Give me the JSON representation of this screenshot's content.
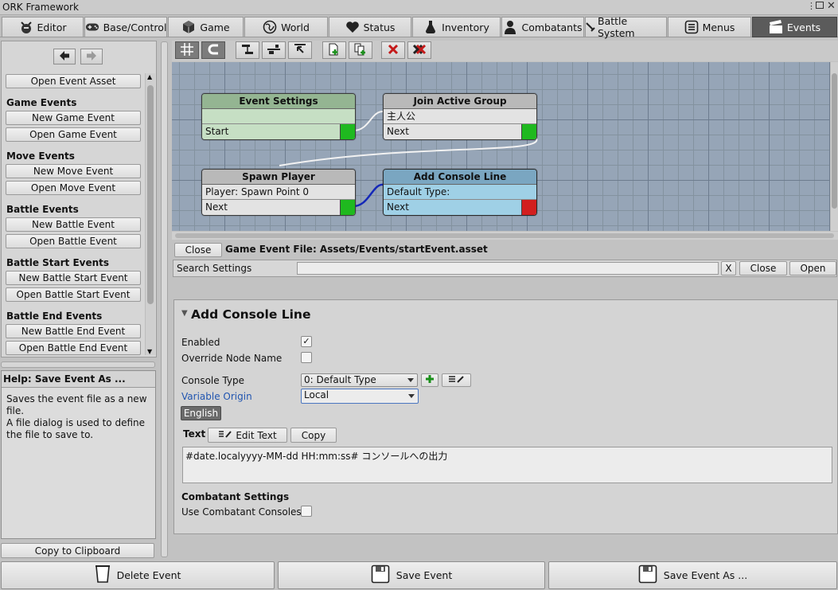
{
  "window": {
    "title": "ORK Framework"
  },
  "tabs": [
    {
      "label": "Editor",
      "icon": "ork-icon"
    },
    {
      "label": "Base/Control",
      "icon": "gamepad-icon"
    },
    {
      "label": "Game",
      "icon": "cube-icon"
    },
    {
      "label": "World",
      "icon": "globe-icon"
    },
    {
      "label": "Status",
      "icon": "heart-icon"
    },
    {
      "label": "Inventory",
      "icon": "potion-icon"
    },
    {
      "label": "Combatants",
      "icon": "person-icon"
    },
    {
      "label": "Battle System",
      "icon": "sword-icon"
    },
    {
      "label": "Menus",
      "icon": "menu-icon"
    },
    {
      "label": "Events",
      "icon": "clapperboard-icon",
      "active": true
    }
  ],
  "sidebar": {
    "open_event_asset": "Open Event Asset",
    "sections": [
      {
        "title": "Game Events",
        "new": "New Game Event",
        "open": "Open Game Event"
      },
      {
        "title": "Move Events",
        "new": "New Move Event",
        "open": "Open Move Event"
      },
      {
        "title": "Battle Events",
        "new": "New Battle Event",
        "open": "Open Battle Event"
      },
      {
        "title": "Battle Start Events",
        "new": "New Battle Start Event",
        "open": "Open Battle Start Event"
      },
      {
        "title": "Battle End Events",
        "new": "New Battle End Event",
        "open": "Open Battle End Event"
      }
    ]
  },
  "help": {
    "title": "Help: Save Event As ...",
    "lines": [
      "Saves the event file as a new file.",
      "A file dialog is used to define the file to save to."
    ],
    "copy_label": "Copy to Clipboard"
  },
  "graph": {
    "nodes": [
      {
        "title": "Event Settings",
        "rows": [
          "",
          "Start"
        ]
      },
      {
        "title": "Join Active Group",
        "rows": [
          "主人公",
          "Next"
        ]
      },
      {
        "title": "Spawn Player",
        "rows": [
          "Player: Spawn Point 0",
          "Next"
        ]
      },
      {
        "title": "Add Console Line",
        "rows": [
          "Default Type:",
          "Next"
        ]
      }
    ],
    "colors": {
      "settings_header": "#94b592",
      "settings_body": "#c6dfc4",
      "default_header": "#b9b9b9",
      "default_body": "#e3e3e3",
      "selected_header": "#7aa6c1",
      "selected_body": "#9fd0e6",
      "port_ok": "#1fb91f",
      "port_open": "#d21f1f"
    }
  },
  "file": {
    "close_label": "Close",
    "path": "Game Event File: Assets/Events/startEvent.asset"
  },
  "search": {
    "label": "Search Settings",
    "value": "",
    "clear_label": "X",
    "close_label": "Close",
    "open_label": "Open"
  },
  "inspector": {
    "title": "Add Console Line",
    "enabled_label": "Enabled",
    "enabled": true,
    "override_label": "Override Node Name",
    "override": false,
    "console_type_label": "Console Type",
    "console_type_value": "0: Default Type",
    "variable_origin_label": "Variable Origin",
    "variable_origin_value": "Local",
    "language_label": "English",
    "text_label": "Text",
    "edit_text_label": "Edit Text",
    "copy_label": "Copy",
    "text_value": "#date.localyyyy-MM-dd HH:mm:ss# コンソールへの出力",
    "combatant_title": "Combatant Settings",
    "use_consoles_label": "Use Combatant Consoles",
    "use_consoles": false
  },
  "footer": {
    "delete_label": "Delete Event",
    "save_label": "Save Event",
    "save_as_label": "Save Event As ..."
  }
}
